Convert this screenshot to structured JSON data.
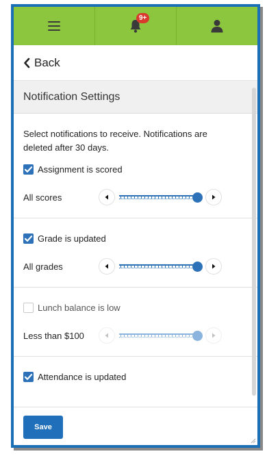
{
  "topbar": {
    "menu_icon": "hamburger-icon",
    "notifications_icon": "bell-icon",
    "notifications_badge": "9+",
    "profile_icon": "user-icon",
    "accent_color": "#8cc63f",
    "badge_color": "#d83a2e"
  },
  "nav": {
    "back_label": "Back",
    "back_icon": "chevron-left-icon"
  },
  "page": {
    "title": "Notification Settings",
    "intro": "Select notifications to receive. Notifications are deleted after 30 days."
  },
  "settings": [
    {
      "label": "Assignment is scored",
      "checked": true,
      "slider_label": "All scores",
      "slider_value": 1.0,
      "enabled": true
    },
    {
      "label": "Grade is updated",
      "checked": true,
      "slider_label": "All grades",
      "slider_value": 1.0,
      "enabled": true
    },
    {
      "label": "Lunch balance is low",
      "checked": false,
      "slider_label": "Less than $100",
      "slider_value": 1.0,
      "enabled": false
    },
    {
      "label": "Attendance is updated",
      "checked": true
    }
  ],
  "footer": {
    "save_label": "Save",
    "primary_color": "#1f6fba"
  }
}
